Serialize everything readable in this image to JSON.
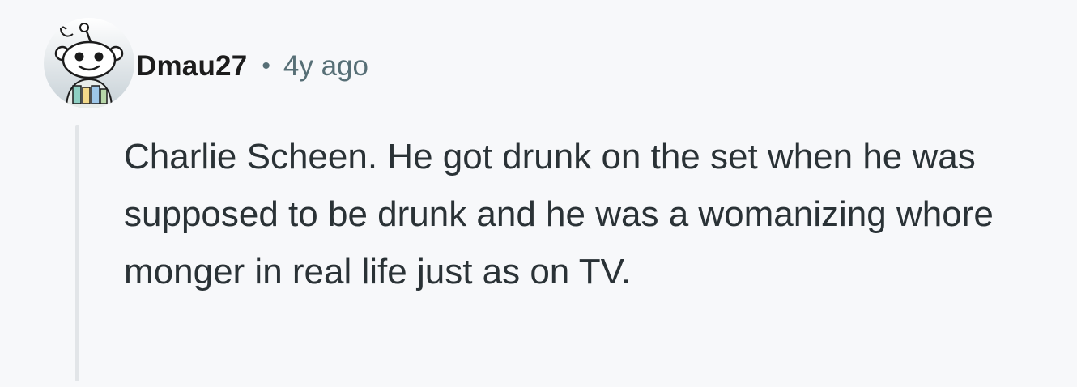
{
  "comment": {
    "author": "Dmau27",
    "separator": "•",
    "timestamp": "4y ago",
    "body": "Charlie Scheen. He got drunk on the set when he was supposed to be drunk and he was a womanizing whore monger in real life just as on TV.",
    "avatar_icon": "snoo-avatar-icon"
  },
  "colors": {
    "background": "#f7f8fa",
    "author": "#1c1c1c",
    "meta": "#576f76",
    "body_text": "#2a3236",
    "thread_line": "#e2e5e8"
  }
}
